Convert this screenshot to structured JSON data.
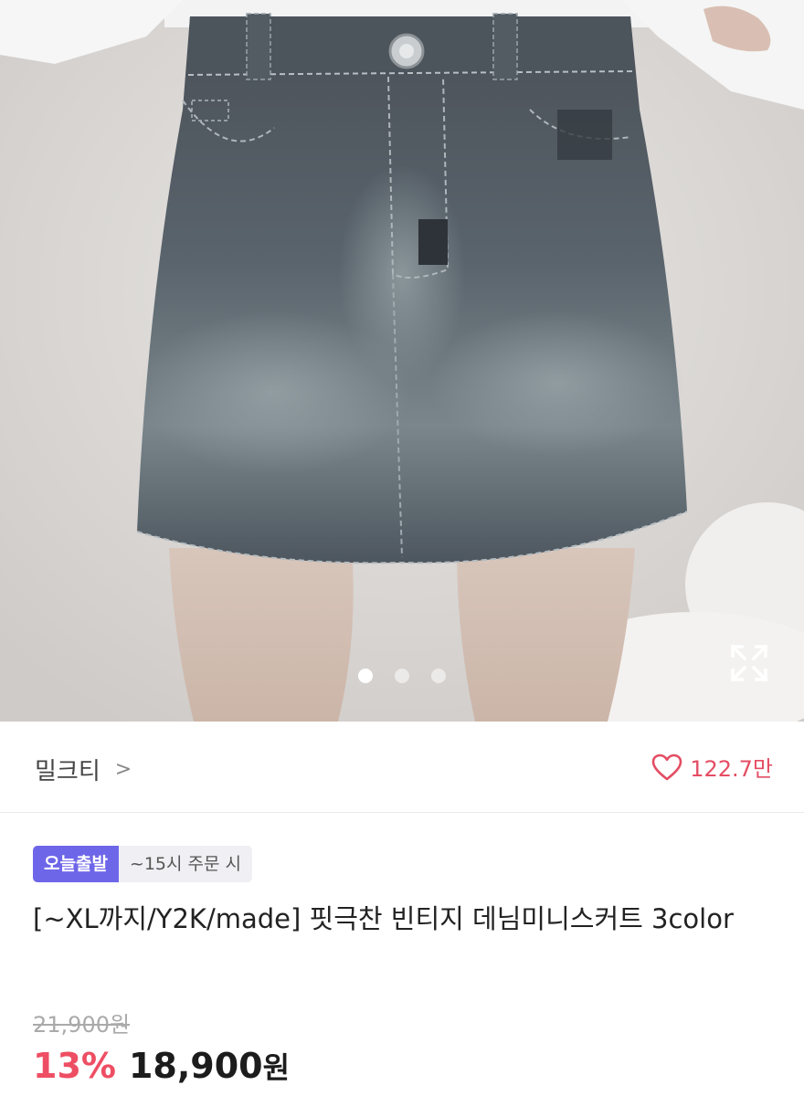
{
  "shop": {
    "name": "밀크티",
    "chevron": ">",
    "likes": "122.7만"
  },
  "badges": {
    "delivery": "오늘출발",
    "cutoff": "~15시 주문 시"
  },
  "product": {
    "title": "[~XL까지/Y2K/made] 핏극찬 빈티지 데님미니스커트 3color",
    "original_price": "21,900원",
    "discount": "13%",
    "price": "18,900",
    "currency": "원"
  },
  "carousel": {
    "total": 3,
    "active": 1
  },
  "colors": {
    "accent": "#ee4e63",
    "badge": "#6e66e8",
    "heart": "#e44d63"
  },
  "icons": [
    "expand-icon",
    "heart-icon",
    "chevron-right-icon"
  ]
}
